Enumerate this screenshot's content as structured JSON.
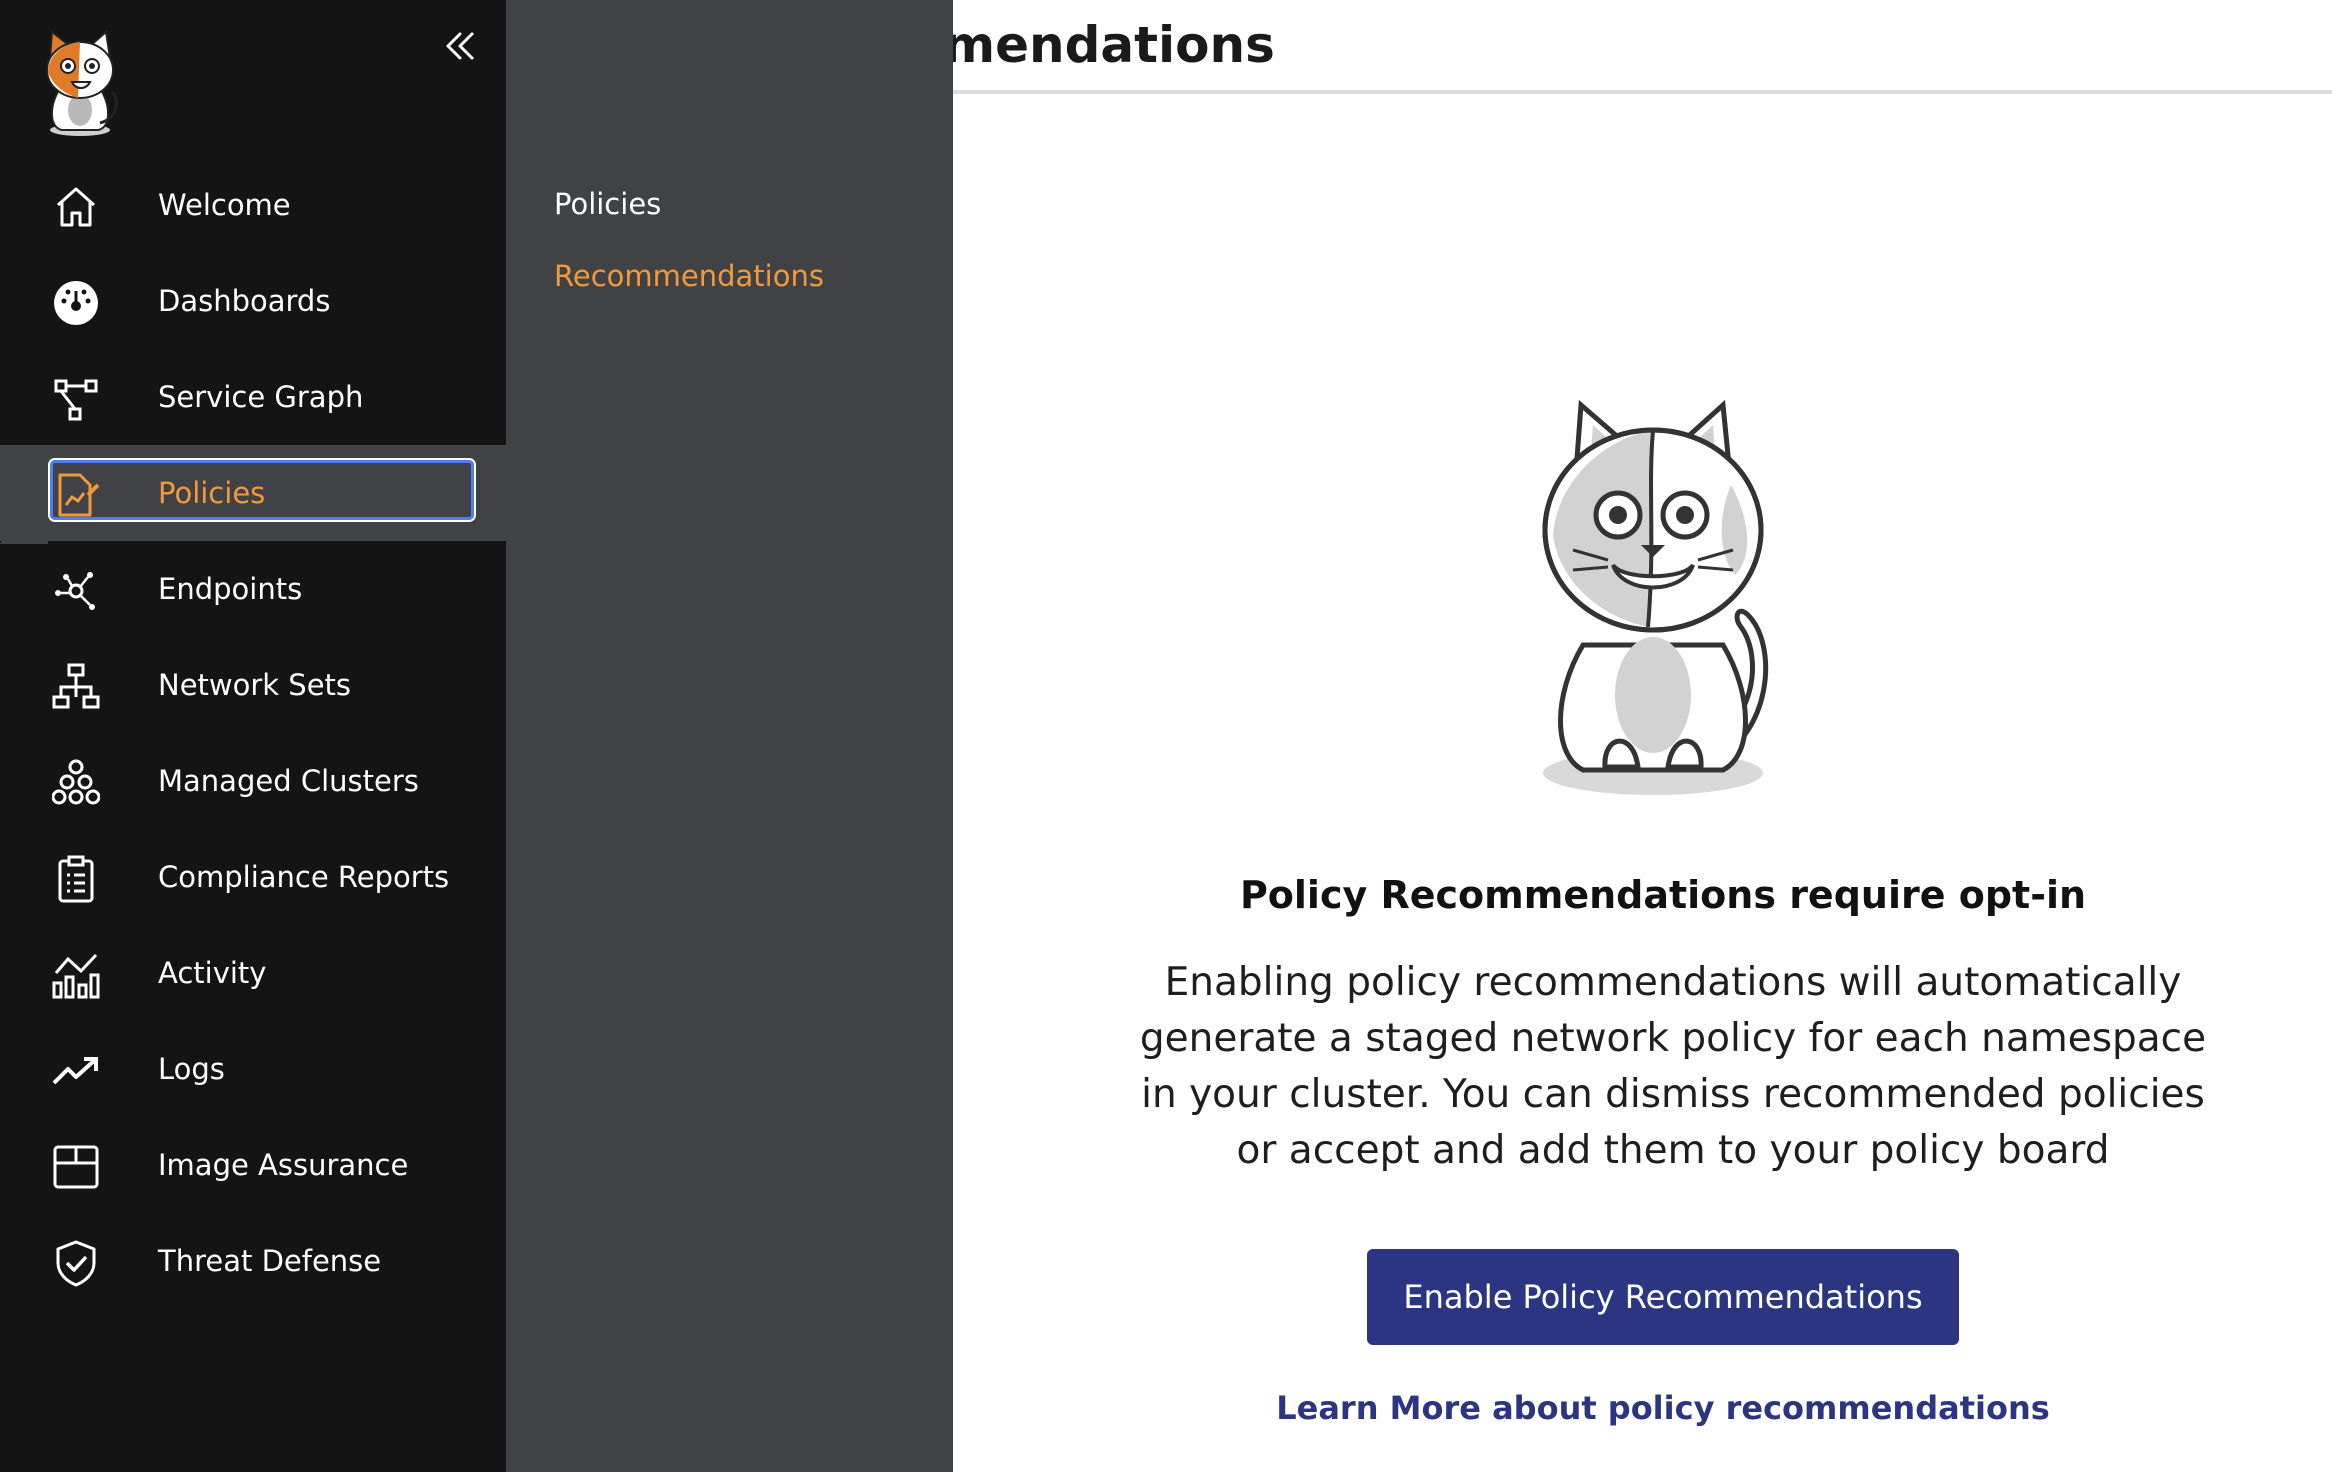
{
  "page": {
    "title": "mendations"
  },
  "sidebar": {
    "items": [
      {
        "label": "Welcome",
        "icon": "home-icon"
      },
      {
        "label": "Dashboards",
        "icon": "dashboard-gauge-icon"
      },
      {
        "label": "Service Graph",
        "icon": "service-graph-icon"
      },
      {
        "label": "Policies",
        "icon": "policy-document-icon",
        "selected": true
      },
      {
        "label": "Endpoints",
        "icon": "endpoints-icon"
      },
      {
        "label": "Network Sets",
        "icon": "network-sets-icon"
      },
      {
        "label": "Managed Clusters",
        "icon": "managed-clusters-icon"
      },
      {
        "label": "Compliance Reports",
        "icon": "clipboard-icon"
      },
      {
        "label": "Activity",
        "icon": "activity-chart-icon"
      },
      {
        "label": "Logs",
        "icon": "trend-arrow-icon"
      },
      {
        "label": "Image Assurance",
        "icon": "box-icon"
      },
      {
        "label": "Threat Defense",
        "icon": "shield-check-icon"
      }
    ]
  },
  "submenu": {
    "items": [
      {
        "label": "Policies",
        "active": false
      },
      {
        "label": "Recommendations",
        "active": true
      }
    ]
  },
  "empty_state": {
    "heading": "Policy Recommendations require opt-in",
    "body": "Enabling policy recommendations will automatically generate a staged network policy for each namespace in your cluster. You can dismiss recommended policies or accept and add them to your policy board",
    "button_label": "Enable Policy Recommendations",
    "link_label": "Learn More about policy recommendations"
  },
  "colors": {
    "sidebar_bg": "#141414",
    "submenu_bg": "#414246",
    "accent_orange": "#f29a3b",
    "primary_button": "#2b3582",
    "focus_ring": "#4d7ff0"
  }
}
